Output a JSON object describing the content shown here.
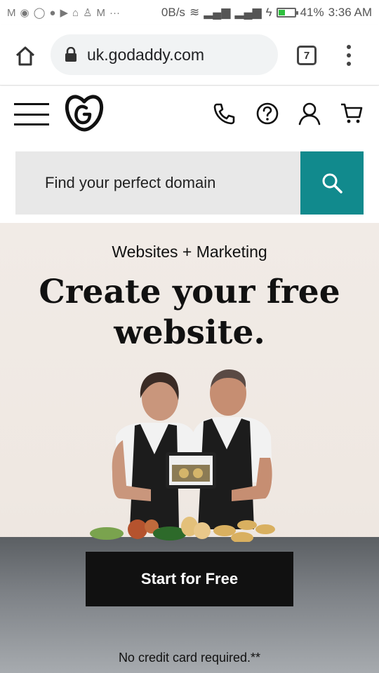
{
  "status_bar": {
    "left_icons": [
      "gmail-icon",
      "telegram-icon",
      "chat-bubble-icon",
      "facebook-icon",
      "youtube-icon",
      "shirt-icon",
      "person-icon",
      "gmail-icon",
      "more-dots-icon"
    ],
    "network_speed": "0B/s",
    "battery_percent": "41%",
    "time": "3:36 AM",
    "battery_level": 0.41,
    "battery_color": "#2dbf3d"
  },
  "browser": {
    "url": "uk.godaddy.com",
    "tab_count": "7"
  },
  "site_header": {
    "icons": [
      "menu-icon",
      "godaddy-logo",
      "phone-icon",
      "help-icon",
      "account-icon",
      "cart-icon"
    ]
  },
  "search": {
    "placeholder": "Find your perfect domain",
    "button_color": "#118a8d"
  },
  "hero": {
    "eyebrow": "Websites + Marketing",
    "headline": "Create your free website.",
    "cta_label": "Start for Free",
    "disclaimer": "No credit card required.**"
  },
  "colors": {
    "accent": "#118a8d",
    "cta_background": "#111111"
  }
}
